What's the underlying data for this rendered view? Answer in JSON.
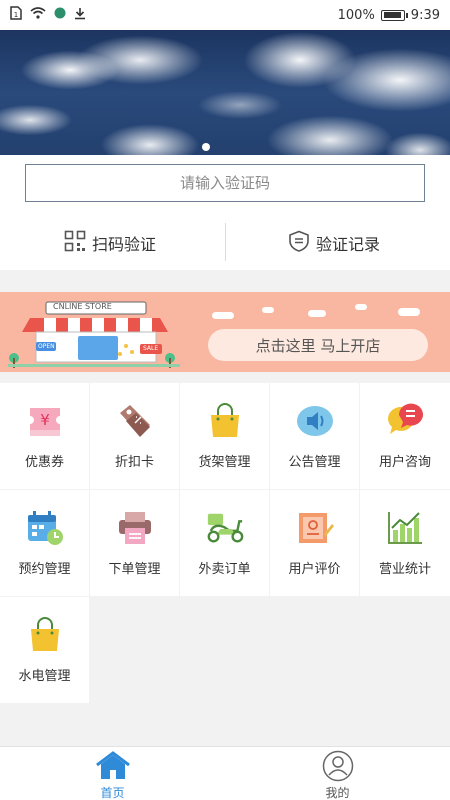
{
  "status_bar": {
    "battery_text": "100%",
    "time": "9:39",
    "battery_level": 1.0
  },
  "banner": {
    "active_slide": 1,
    "slide_count": 1
  },
  "verify": {
    "input_placeholder": "请输入验证码",
    "input_value": "",
    "scan_label": "扫码验证",
    "records_label": "验证记录"
  },
  "promo": {
    "store_sign": "CNLINE STORE",
    "tag_open": "OPEN",
    "tag_sale": "SALE",
    "button_label": "点击这里 马上开店"
  },
  "grid": {
    "items": [
      {
        "label": "优惠券",
        "icon": "coupon-icon"
      },
      {
        "label": "折扣卡",
        "icon": "discount-tag-icon"
      },
      {
        "label": "货架管理",
        "icon": "shopping-bag-icon"
      },
      {
        "label": "公告管理",
        "icon": "speaker-icon"
      },
      {
        "label": "用户咨询",
        "icon": "chat-bubbles-icon"
      },
      {
        "label": "预约管理",
        "icon": "calendar-clock-icon"
      },
      {
        "label": "下单管理",
        "icon": "printer-icon"
      },
      {
        "label": "外卖订单",
        "icon": "scooter-icon"
      },
      {
        "label": "用户评价",
        "icon": "review-note-icon"
      },
      {
        "label": "营业统计",
        "icon": "bar-chart-icon"
      },
      {
        "label": "水电管理",
        "icon": "shopping-bag-icon"
      }
    ]
  },
  "bottom_nav": {
    "home_label": "首页",
    "me_label": "我的",
    "active": "首页"
  },
  "colors": {
    "accent_blue": "#2f8ad8",
    "promo_bg": "#f9b6a0",
    "promo_button_bg": "#fde9df",
    "page_bg": "#f2f2f2"
  }
}
